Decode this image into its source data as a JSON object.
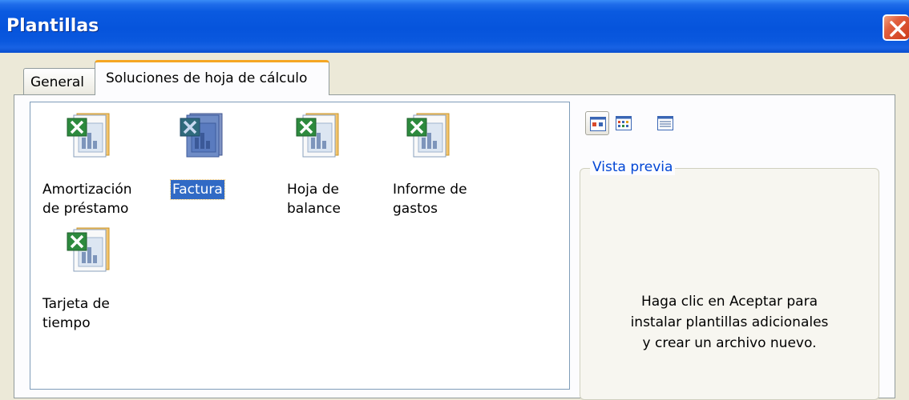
{
  "window": {
    "title": "Plantillas"
  },
  "tabs": [
    {
      "label": "General",
      "selected": false
    },
    {
      "label": "Soluciones de hoja de cálculo",
      "selected": true
    }
  ],
  "templates": [
    {
      "label": "Amortización\nde préstamo",
      "icon": "excel-template-icon",
      "selected": false
    },
    {
      "label": "Factura",
      "icon": "excel-template-icon",
      "selected": true
    },
    {
      "label": "Hoja de\nbalance",
      "icon": "excel-template-icon",
      "selected": false
    },
    {
      "label": "Informe de\ngastos",
      "icon": "excel-template-icon",
      "selected": false
    },
    {
      "label": "Tarjeta de\ntiempo",
      "icon": "excel-template-icon",
      "selected": false
    }
  ],
  "view_buttons": [
    {
      "name": "large-icons-view-icon",
      "active": true
    },
    {
      "name": "list-view-icon",
      "active": false
    },
    {
      "name": "details-view-icon",
      "active": false
    }
  ],
  "preview": {
    "legend": "Vista previa",
    "message": "Haga clic en Aceptar para\ninstalar plantillas adicionales\ny crear un archivo nuevo."
  },
  "colors": {
    "titlebar": "#0654dc",
    "selection": "#316ac5",
    "tab_accent": "#f5a623",
    "excel_green": "#2d8a3e",
    "legend_blue": "#0046d5"
  }
}
